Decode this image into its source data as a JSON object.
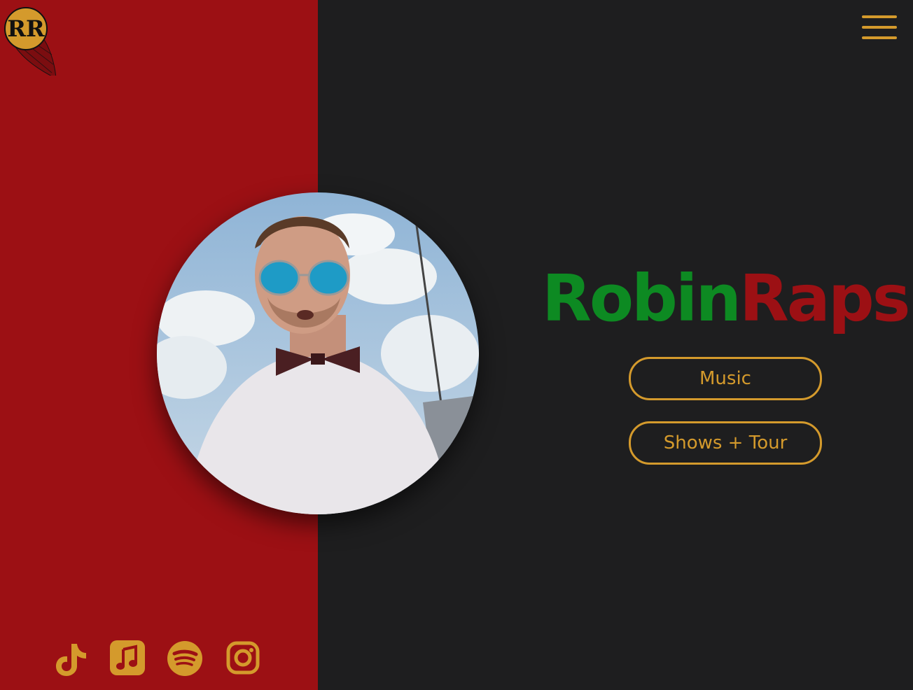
{
  "brand": {
    "part1": "Robin",
    "part2": "Raps",
    "part1_color": "#0d8a22",
    "part2_color": "#9c1014"
  },
  "logo": {
    "text": "RR",
    "icon": "rr-logo-icon"
  },
  "header": {
    "menu_icon": "hamburger-menu-icon"
  },
  "nav_buttons": [
    {
      "label": "Music"
    },
    {
      "label": "Shows + Tour"
    }
  ],
  "social_links": [
    {
      "icon": "tiktok-icon"
    },
    {
      "icon": "apple-music-icon"
    },
    {
      "icon": "spotify-icon"
    },
    {
      "icon": "instagram-icon"
    }
  ],
  "colors": {
    "left_panel": "#9c1014",
    "right_panel": "#1e1e1f",
    "accent_gold": "#d49a2c"
  }
}
